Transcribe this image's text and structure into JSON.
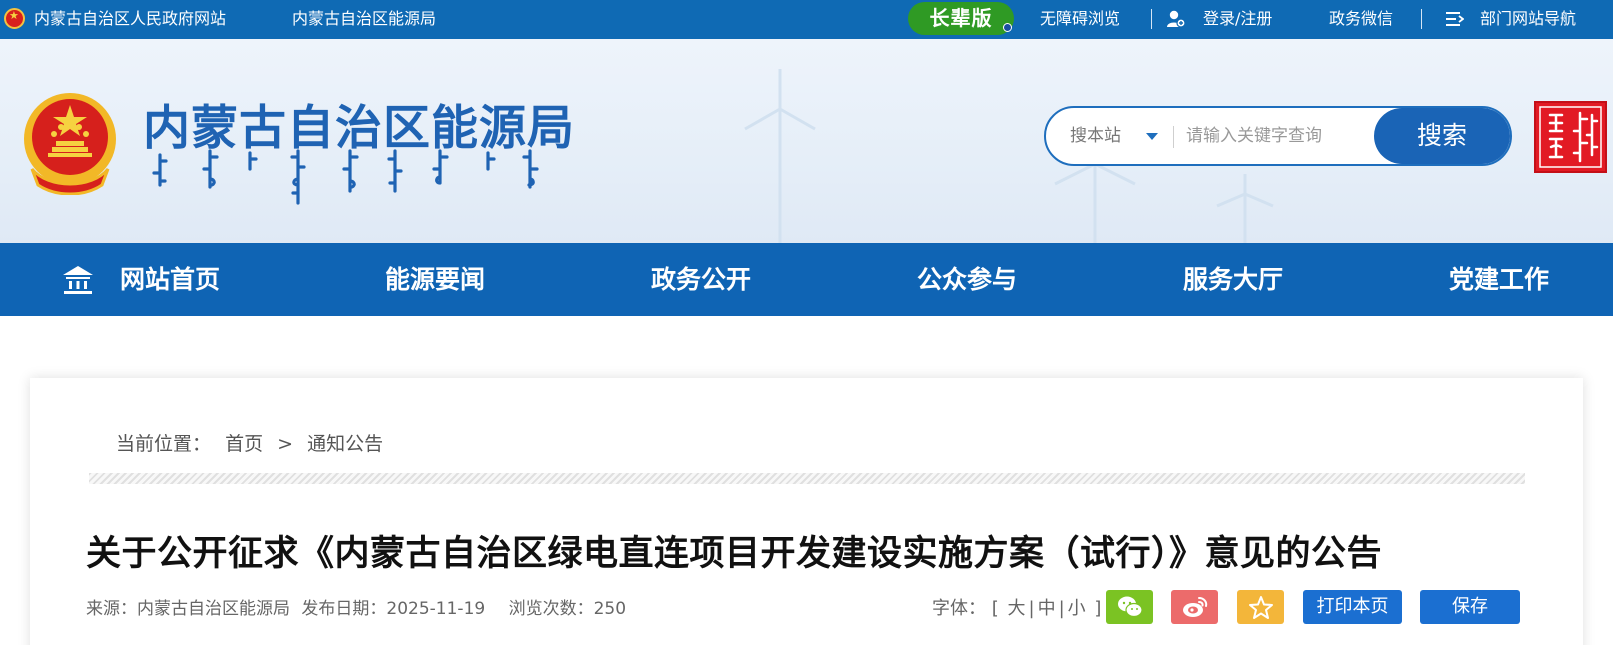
{
  "topbar": {
    "gov_link": "内蒙古自治区人民政府网站",
    "bureau_link": "内蒙古自治区能源局",
    "elder_mode": "长辈版",
    "accessibility": "无障碍浏览",
    "login": "登录/注册",
    "wechat": "政务微信",
    "dept_nav": "部门网站导航"
  },
  "header": {
    "site_title": "内蒙古自治区能源局",
    "search": {
      "scope": "搜本站",
      "placeholder": "请输入关键字查询",
      "button": "搜索"
    },
    "colors": {
      "brand_blue": "#1a64b6",
      "title_blue": "#1f63b3",
      "seal_red": "#e21a24"
    }
  },
  "nav": {
    "items": [
      "网站首页",
      "能源要闻",
      "政务公开",
      "公众参与",
      "服务大厅",
      "党建工作"
    ]
  },
  "breadcrumb": {
    "label": "当前位置：",
    "home": "首页",
    "separator": ">",
    "current": "通知公告"
  },
  "article": {
    "title": "关于公开征求《内蒙古自治区绿电直连项目开发建设实施方案（试行）》意见的公告",
    "source": "来源：内蒙古自治区能源局",
    "date": "发布日期：2025-11-19",
    "views": "浏览次数：250",
    "font_label": "字体：",
    "font_open": "[",
    "font_large": "大",
    "font_sep1": "|",
    "font_medium": "中",
    "font_sep2": "|",
    "font_small": "小",
    "font_close": "]",
    "share_icons": [
      "wechat-icon",
      "weibo-icon",
      "favorite-icon"
    ],
    "print_btn": "打印本页",
    "save_btn": "保存"
  }
}
